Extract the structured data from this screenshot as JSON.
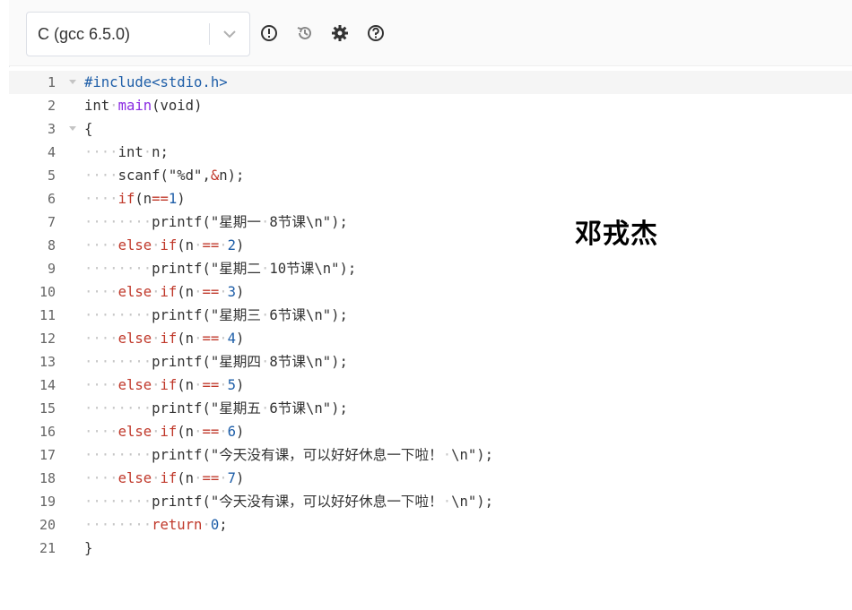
{
  "toolbar": {
    "language_value": "C (gcc 6.5.0)",
    "icons": [
      "info-circle-icon",
      "history-icon",
      "gear-icon",
      "help-circle-icon"
    ]
  },
  "editor": {
    "line_numbers": [
      "1",
      "2",
      "3",
      "4",
      "5",
      "6",
      "7",
      "8",
      "9",
      "10",
      "11",
      "12",
      "13",
      "14",
      "15",
      "16",
      "17",
      "18",
      "19",
      "20",
      "21"
    ],
    "fold_markers": [
      true,
      false,
      true,
      false,
      false,
      false,
      false,
      false,
      false,
      false,
      false,
      false,
      false,
      false,
      false,
      false,
      false,
      false,
      false,
      false,
      false
    ],
    "tokens": [
      [
        [
          "pp",
          "#include<stdio.h>"
        ]
      ],
      [
        [
          "pl",
          "int"
        ],
        [
          "ws",
          "·"
        ],
        [
          "fn",
          "main"
        ],
        [
          "pl",
          "(void)"
        ]
      ],
      [
        [
          "pl",
          "{"
        ]
      ],
      [
        [
          "ws",
          "····"
        ],
        [
          "pl",
          "int"
        ],
        [
          "ws",
          "·"
        ],
        [
          "pl",
          "n;"
        ]
      ],
      [
        [
          "ws",
          "····"
        ],
        [
          "pl",
          "scanf(\"%d\","
        ],
        [
          "op",
          "&"
        ],
        [
          "pl",
          "n);"
        ]
      ],
      [
        [
          "ws",
          "····"
        ],
        [
          "kw",
          "if"
        ],
        [
          "pl",
          "(n"
        ],
        [
          "op",
          "=="
        ],
        [
          "num",
          "1"
        ],
        [
          "pl",
          ")"
        ]
      ],
      [
        [
          "ws",
          "········"
        ],
        [
          "pl",
          "printf(\"星期一"
        ],
        [
          "ws",
          "·"
        ],
        [
          "pl",
          "8节课\\n\");"
        ]
      ],
      [
        [
          "ws",
          "····"
        ],
        [
          "kw",
          "else"
        ],
        [
          "ws",
          "·"
        ],
        [
          "kw",
          "if"
        ],
        [
          "pl",
          "(n"
        ],
        [
          "ws",
          "·"
        ],
        [
          "op",
          "=="
        ],
        [
          "ws",
          "·"
        ],
        [
          "num",
          "2"
        ],
        [
          "pl",
          ")"
        ]
      ],
      [
        [
          "ws",
          "········"
        ],
        [
          "pl",
          "printf(\"星期二"
        ],
        [
          "ws",
          "·"
        ],
        [
          "pl",
          "10节课\\n\");"
        ]
      ],
      [
        [
          "ws",
          "····"
        ],
        [
          "kw",
          "else"
        ],
        [
          "ws",
          "·"
        ],
        [
          "kw",
          "if"
        ],
        [
          "pl",
          "(n"
        ],
        [
          "ws",
          "·"
        ],
        [
          "op",
          "=="
        ],
        [
          "ws",
          "·"
        ],
        [
          "num",
          "3"
        ],
        [
          "pl",
          ")"
        ]
      ],
      [
        [
          "ws",
          "········"
        ],
        [
          "pl",
          "printf(\"星期三"
        ],
        [
          "ws",
          "·"
        ],
        [
          "pl",
          "6节课\\n\");"
        ]
      ],
      [
        [
          "ws",
          "····"
        ],
        [
          "kw",
          "else"
        ],
        [
          "ws",
          "·"
        ],
        [
          "kw",
          "if"
        ],
        [
          "pl",
          "(n"
        ],
        [
          "ws",
          "·"
        ],
        [
          "op",
          "=="
        ],
        [
          "ws",
          "·"
        ],
        [
          "num",
          "4"
        ],
        [
          "pl",
          ")"
        ]
      ],
      [
        [
          "ws",
          "········"
        ],
        [
          "pl",
          "printf(\"星期四"
        ],
        [
          "ws",
          "·"
        ],
        [
          "pl",
          "8节课\\n\");"
        ]
      ],
      [
        [
          "ws",
          "····"
        ],
        [
          "kw",
          "else"
        ],
        [
          "ws",
          "·"
        ],
        [
          "kw",
          "if"
        ],
        [
          "pl",
          "(n"
        ],
        [
          "ws",
          "·"
        ],
        [
          "op",
          "=="
        ],
        [
          "ws",
          "·"
        ],
        [
          "num",
          "5"
        ],
        [
          "pl",
          ")"
        ]
      ],
      [
        [
          "ws",
          "········"
        ],
        [
          "pl",
          "printf(\"星期五"
        ],
        [
          "ws",
          "·"
        ],
        [
          "pl",
          "6节课\\n\");"
        ]
      ],
      [
        [
          "ws",
          "····"
        ],
        [
          "kw",
          "else"
        ],
        [
          "ws",
          "·"
        ],
        [
          "kw",
          "if"
        ],
        [
          "pl",
          "(n"
        ],
        [
          "ws",
          "·"
        ],
        [
          "op",
          "=="
        ],
        [
          "ws",
          "·"
        ],
        [
          "num",
          "6"
        ],
        [
          "pl",
          ")"
        ]
      ],
      [
        [
          "ws",
          "········"
        ],
        [
          "pl",
          "printf(\"今天没有课，可以好好休息一下啦！"
        ],
        [
          "ws",
          "·"
        ],
        [
          "pl",
          "\\n\");"
        ]
      ],
      [
        [
          "ws",
          "····"
        ],
        [
          "kw",
          "else"
        ],
        [
          "ws",
          "·"
        ],
        [
          "kw",
          "if"
        ],
        [
          "pl",
          "(n"
        ],
        [
          "ws",
          "·"
        ],
        [
          "op",
          "=="
        ],
        [
          "ws",
          "·"
        ],
        [
          "num",
          "7"
        ],
        [
          "pl",
          ")"
        ]
      ],
      [
        [
          "ws",
          "········"
        ],
        [
          "pl",
          "printf(\"今天没有课，可以好好休息一下啦！"
        ],
        [
          "ws",
          "·"
        ],
        [
          "pl",
          "\\n\");"
        ]
      ],
      [
        [
          "ws",
          "········"
        ],
        [
          "kw",
          "return"
        ],
        [
          "ws",
          "·"
        ],
        [
          "num",
          "0"
        ],
        [
          "pl",
          ";"
        ]
      ],
      [
        [
          "pl",
          "}"
        ]
      ]
    ]
  },
  "overlay": {
    "name_text": "邓戎杰"
  }
}
